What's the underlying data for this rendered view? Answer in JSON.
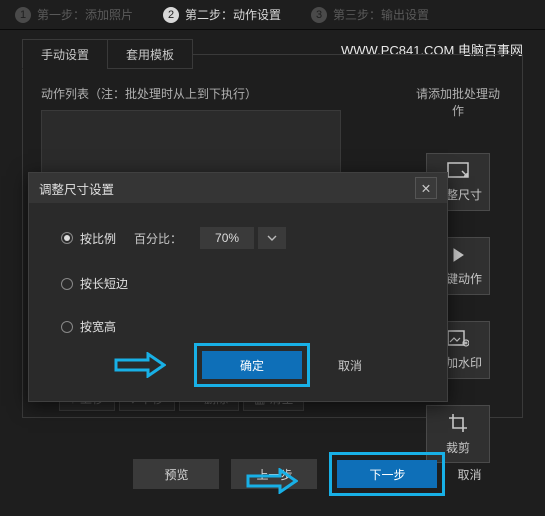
{
  "steps": {
    "s1": "第一步：添加照片",
    "s2": "第二步：动作设置",
    "s3": "第三步：输出设置"
  },
  "brand": "WWW.PC841.COM 电脑百事网",
  "tabs": {
    "manual": "手动设置",
    "template": "套用模板"
  },
  "content": {
    "list_label": "动作列表（注：批处理时从上到下执行）",
    "add_hint": "请添加批处理动作"
  },
  "side_actions": {
    "resize": "调整尺寸",
    "onekey": "一键动作",
    "watermark": "添加水印",
    "crop": "裁剪"
  },
  "action_bar": {
    "up": "上移",
    "down": "下移",
    "delete": "删除",
    "clear": "清空"
  },
  "bottom": {
    "preview": "预览",
    "prev": "上一步",
    "next": "下一步",
    "cancel": "取消"
  },
  "dialog": {
    "title": "调整尺寸设置",
    "by_ratio": "按比例",
    "percent_label": "百分比：",
    "percent_value": "70%",
    "by_short": "按长短边",
    "by_wh": "按宽高",
    "ok": "确定",
    "cancel": "取消"
  }
}
